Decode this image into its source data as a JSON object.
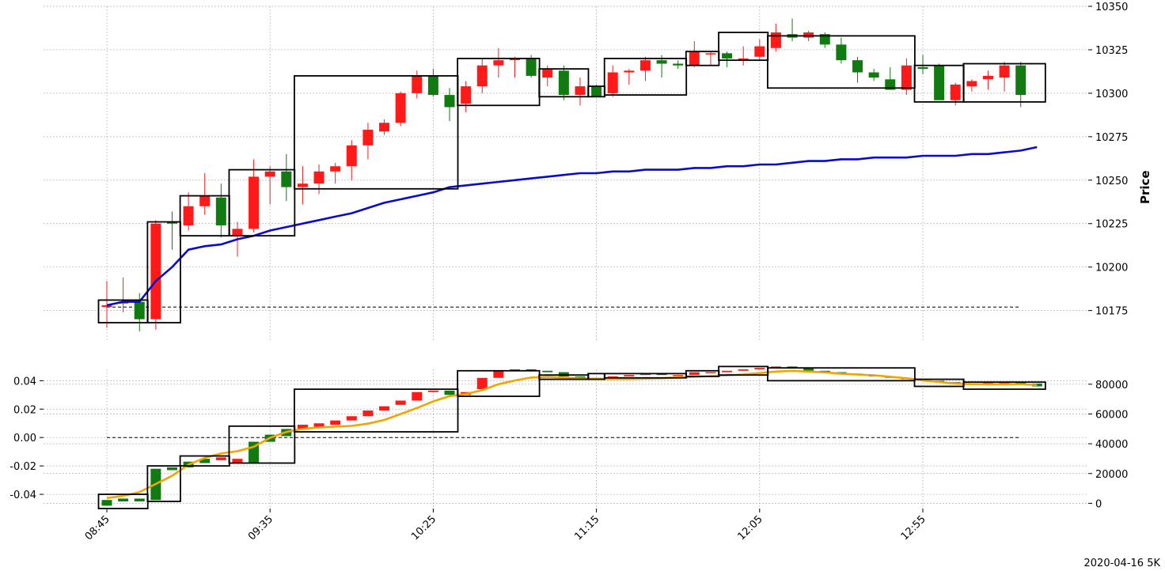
{
  "chart_data": {
    "type": "candlestick",
    "footer": "2020-04-16 5K",
    "price_panel": {
      "ylabel": "Price",
      "ylim": [
        10158,
        10350
      ],
      "yticks": [
        10175,
        10200,
        10225,
        10250,
        10275,
        10300,
        10325,
        10350
      ],
      "baseline": 10177,
      "candles": [
        [
          10177,
          10192,
          10165,
          10178
        ],
        [
          10179,
          10194,
          10174,
          10180
        ],
        [
          10180,
          10185,
          10163,
          10170
        ],
        [
          10170,
          10227,
          10164,
          10225
        ],
        [
          10226,
          10232,
          10210,
          10225
        ],
        [
          10224,
          10243,
          10221,
          10235
        ],
        [
          10235,
          10254,
          10230,
          10241
        ],
        [
          10240,
          10248,
          10217,
          10224
        ],
        [
          10218,
          10226,
          10206,
          10222
        ],
        [
          10222,
          10262,
          10220,
          10252
        ],
        [
          10252,
          10258,
          10236,
          10255
        ],
        [
          10255,
          10265,
          10238,
          10246
        ],
        [
          10246,
          10258,
          10236,
          10248
        ],
        [
          10248,
          10259,
          10242,
          10255
        ],
        [
          10255,
          10260,
          10248,
          10258
        ],
        [
          10258,
          10273,
          10250,
          10270
        ],
        [
          10270,
          10283,
          10262,
          10279
        ],
        [
          10278,
          10285,
          10276,
          10283
        ],
        [
          10283,
          10301,
          10281,
          10300
        ],
        [
          10300,
          10313,
          10297,
          10310
        ],
        [
          10310,
          10314,
          10298,
          10299
        ],
        [
          10299,
          10303,
          10284,
          10292
        ],
        [
          10294,
          10307,
          10289,
          10304
        ],
        [
          10304,
          10320,
          10300,
          10316
        ],
        [
          10316,
          10326,
          10309,
          10319
        ],
        [
          10319,
          10321,
          10309,
          10320
        ],
        [
          10320,
          10322,
          10309,
          10310
        ],
        [
          10309,
          10316,
          10304,
          10314
        ],
        [
          10313,
          10316,
          10296,
          10299
        ],
        [
          10299,
          10309,
          10293,
          10304
        ],
        [
          10304,
          10305,
          10298,
          10298
        ],
        [
          10300,
          10316,
          10298,
          10312
        ],
        [
          10312,
          10314,
          10305,
          10313
        ],
        [
          10313,
          10321,
          10307,
          10319
        ],
        [
          10319,
          10322,
          10309,
          10317
        ],
        [
          10317,
          10319,
          10314,
          10316
        ],
        [
          10316,
          10330,
          10315,
          10324
        ],
        [
          10323,
          10324,
          10316,
          10323
        ],
        [
          10323,
          10324,
          10315,
          10320
        ],
        [
          10319,
          10327,
          10316,
          10320
        ],
        [
          10321,
          10331,
          10319,
          10327
        ],
        [
          10326,
          10340,
          10324,
          10335
        ],
        [
          10334,
          10343,
          10330,
          10332
        ],
        [
          10332,
          10336,
          10330,
          10335
        ],
        [
          10334,
          10335,
          10326,
          10328
        ],
        [
          10328,
          10332,
          10317,
          10319
        ],
        [
          10319,
          10321,
          10306,
          10312
        ],
        [
          10312,
          10314,
          10307,
          10309
        ],
        [
          10308,
          10315,
          10302,
          10302
        ],
        [
          10302,
          10320,
          10299,
          10316
        ],
        [
          10315,
          10322,
          10311,
          10314
        ],
        [
          10316,
          10317,
          10296,
          10296
        ],
        [
          10296,
          10306,
          10293,
          10305
        ],
        [
          10304,
          10308,
          10301,
          10307
        ],
        [
          10308,
          10313,
          10302,
          10310
        ],
        [
          10309,
          10318,
          10301,
          10316
        ],
        [
          10316,
          10318,
          10292,
          10299
        ]
      ],
      "vwap": [
        10178,
        10180,
        10180,
        10192,
        10200,
        10210,
        10212,
        10213,
        10216,
        10218,
        10221,
        10223,
        10225,
        10227,
        10229,
        10231,
        10234,
        10237,
        10239,
        10241,
        10243,
        10246,
        10247,
        10248,
        10249,
        10250,
        10251,
        10252,
        10253,
        10254,
        10254,
        10255,
        10255,
        10256,
        10256,
        10256,
        10257,
        10257,
        10258,
        10258,
        10259,
        10259,
        10260,
        10261,
        10261,
        10262,
        10262,
        10263,
        10263,
        10263,
        10264,
        10264,
        10264,
        10265,
        10265,
        10266,
        10267,
        10269
      ],
      "boxes": [
        {
          "i0": 0,
          "i1": 2,
          "lo": 10168,
          "hi": 10181
        },
        {
          "i0": 3,
          "i1": 4,
          "lo": 10168,
          "hi": 10226
        },
        {
          "i0": 5,
          "i1": 7,
          "lo": 10218,
          "hi": 10241
        },
        {
          "i0": 8,
          "i1": 11,
          "lo": 10218,
          "hi": 10256
        },
        {
          "i0": 12,
          "i1": 21,
          "lo": 10245,
          "hi": 10310
        },
        {
          "i0": 22,
          "i1": 26,
          "lo": 10293,
          "hi": 10320
        },
        {
          "i0": 27,
          "i1": 29,
          "lo": 10298,
          "hi": 10314
        },
        {
          "i0": 30,
          "i1": 30,
          "lo": 10298,
          "hi": 10304
        },
        {
          "i0": 31,
          "i1": 35,
          "lo": 10299,
          "hi": 10320
        },
        {
          "i0": 36,
          "i1": 37,
          "lo": 10316,
          "hi": 10324
        },
        {
          "i0": 38,
          "i1": 40,
          "lo": 10319,
          "hi": 10335
        },
        {
          "i0": 41,
          "i1": 49,
          "lo": 10303,
          "hi": 10333
        },
        {
          "i0": 50,
          "i1": 52,
          "lo": 10295,
          "hi": 10316
        },
        {
          "i0": 53,
          "i1": 57,
          "lo": 10295,
          "hi": 10317
        }
      ]
    },
    "lower_panel": {
      "left_ylim": [
        -0.05,
        0.048
      ],
      "left_yticks": [
        "-0.04",
        "-0.02",
        "0.00",
        "0.02",
        "0.04"
      ],
      "right_ylim": [
        -3500,
        90000
      ],
      "right_yticks": [
        "0",
        "20000",
        "40000",
        "60000",
        "80000"
      ],
      "baseline": 0,
      "candles": [
        [
          -0.044,
          -0.048
        ],
        [
          -0.043,
          -0.045
        ],
        [
          -0.043,
          -0.045
        ],
        [
          -0.022,
          -0.044
        ],
        [
          -0.021,
          -0.023
        ],
        [
          -0.017,
          -0.021
        ],
        [
          -0.015,
          -0.018
        ],
        [
          -0.016,
          -0.014
        ],
        [
          -0.018,
          -0.015
        ],
        [
          -0.003,
          -0.018
        ],
        [
          0.002,
          -0.003
        ],
        [
          0.006,
          0.001
        ],
        [
          0.006,
          0.009
        ],
        [
          0.007,
          0.01
        ],
        [
          0.009,
          0.012
        ],
        [
          0.012,
          0.015
        ],
        [
          0.015,
          0.019
        ],
        [
          0.019,
          0.022
        ],
        [
          0.023,
          0.026
        ],
        [
          0.026,
          0.032
        ],
        [
          0.032,
          0.033
        ],
        [
          0.033,
          0.03
        ],
        [
          0.03,
          0.032
        ],
        [
          0.034,
          0.042
        ],
        [
          0.042,
          0.047
        ],
        [
          0.047,
          0.048
        ],
        [
          0.048,
          0.047
        ],
        [
          0.047,
          0.046
        ],
        [
          0.046,
          0.043
        ],
        [
          0.043,
          0.042
        ],
        [
          0.042,
          0.042
        ],
        [
          0.042,
          0.043
        ],
        [
          0.043,
          0.044
        ],
        [
          0.044,
          0.045
        ],
        [
          0.045,
          0.044
        ],
        [
          0.044,
          0.044
        ],
        [
          0.044,
          0.046
        ],
        [
          0.046,
          0.046
        ],
        [
          0.046,
          0.047
        ],
        [
          0.047,
          0.048
        ],
        [
          0.048,
          0.049
        ],
        [
          0.049,
          0.05
        ],
        [
          0.05,
          0.049
        ],
        [
          0.049,
          0.047
        ],
        [
          0.047,
          0.046
        ],
        [
          0.046,
          0.045
        ],
        [
          0.045,
          0.044
        ],
        [
          0.044,
          0.043
        ],
        [
          0.043,
          0.042
        ],
        [
          0.042,
          0.041
        ],
        [
          0.041,
          0.04
        ],
        [
          0.04,
          0.039
        ],
        [
          0.039,
          0.038
        ],
        [
          0.038,
          0.038
        ],
        [
          0.038,
          0.039
        ],
        [
          0.039,
          0.039
        ],
        [
          0.039,
          0.038
        ],
        [
          0.038,
          0.036
        ]
      ],
      "line": [
        3500,
        5000,
        7500,
        13000,
        18500,
        26000,
        30500,
        33500,
        35000,
        38000,
        44000,
        48000,
        50000,
        51000,
        51500,
        52000,
        53500,
        56000,
        60000,
        64000,
        68500,
        72000,
        73500,
        76000,
        80000,
        82500,
        84500,
        85000,
        84500,
        84000,
        83500,
        83500,
        83500,
        83800,
        84000,
        84500,
        85000,
        85500,
        86000,
        86500,
        87500,
        88500,
        89000,
        88500,
        88000,
        87000,
        86500,
        86000,
        85000,
        84000,
        82500,
        81500,
        80500,
        80000,
        80000,
        80000,
        80000,
        79500
      ],
      "boxes": [
        {
          "i0": 0,
          "i1": 2,
          "lo": -0.05,
          "hi": -0.04
        },
        {
          "i0": 3,
          "i1": 4,
          "lo": -0.045,
          "hi": -0.02
        },
        {
          "i0": 5,
          "i1": 7,
          "lo": -0.02,
          "hi": -0.013
        },
        {
          "i0": 8,
          "i1": 11,
          "lo": -0.018,
          "hi": 0.008
        },
        {
          "i0": 12,
          "i1": 21,
          "lo": 0.004,
          "hi": 0.034
        },
        {
          "i0": 22,
          "i1": 26,
          "lo": 0.029,
          "hi": 0.047
        },
        {
          "i0": 27,
          "i1": 29,
          "lo": 0.041,
          "hi": 0.044
        },
        {
          "i0": 30,
          "i1": 30,
          "lo": 0.041,
          "hi": 0.045
        },
        {
          "i0": 31,
          "i1": 35,
          "lo": 0.042,
          "hi": 0.045
        },
        {
          "i0": 36,
          "i1": 37,
          "lo": 0.043,
          "hi": 0.047
        },
        {
          "i0": 38,
          "i1": 40,
          "lo": 0.044,
          "hi": 0.05
        },
        {
          "i0": 41,
          "i1": 49,
          "lo": 0.04,
          "hi": 0.049
        },
        {
          "i0": 50,
          "i1": 52,
          "lo": 0.036,
          "hi": 0.041
        },
        {
          "i0": 53,
          "i1": 57,
          "lo": 0.034,
          "hi": 0.039
        }
      ]
    },
    "x_ticks": [
      {
        "index": 0,
        "label": "08:45"
      },
      {
        "index": 10,
        "label": "09:35"
      },
      {
        "index": 20,
        "label": "10:25"
      },
      {
        "index": 30,
        "label": "11:15"
      },
      {
        "index": 40,
        "label": "12:05"
      },
      {
        "index": 50,
        "label": "12:55"
      }
    ],
    "colors": {
      "up": "#ff1a1a",
      "down": "#117a11",
      "vwap": "#0a0acc",
      "line": "#f0a500",
      "box": "#000000",
      "grid": "#b0b0b0"
    }
  }
}
